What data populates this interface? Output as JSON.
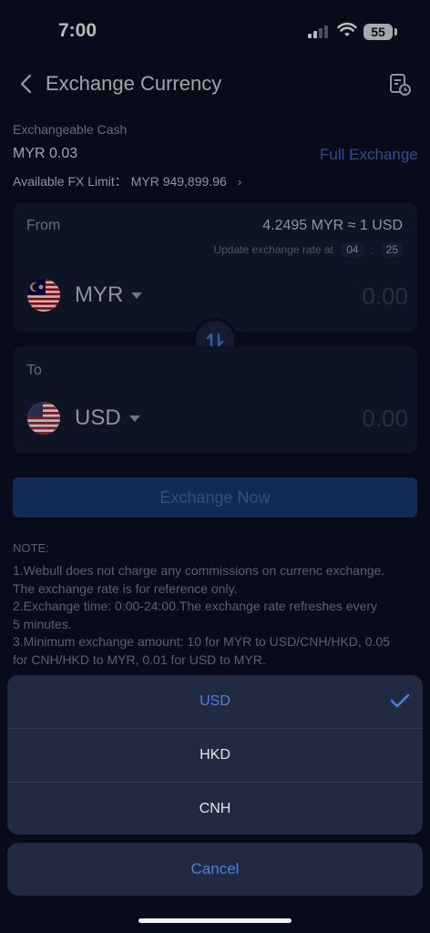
{
  "status": {
    "time": "7:00",
    "battery": "55"
  },
  "header": {
    "title": "Exchange Currency"
  },
  "cash": {
    "label": "Exchangeable Cash",
    "value": "MYR 0.03",
    "full_exchange": "Full Exchange"
  },
  "fx_limit": {
    "label": "Available FX Limit：",
    "value": "MYR 949,899.96"
  },
  "from": {
    "label": "From",
    "rate": "4.2495 MYR ≈ 1 USD",
    "update_label": "Update exchange rate at",
    "update_min": "04",
    "update_sec": "25",
    "currency": "MYR",
    "amount_placeholder": "0.00"
  },
  "to": {
    "label": "To",
    "currency": "USD",
    "amount_placeholder": "0.00"
  },
  "exchange_button": "Exchange Now",
  "note": {
    "title": "NOTE:",
    "lines": [
      "1.Webull does not charge any commissions on currenc exchange.",
      "The exchange rate is for reference only.",
      "2.Exchange time: 0:00-24:00.The exchange rate refreshes every",
      "5 minutes.",
      "3.Minimum exchange amount: 10 for MYR to USD/CNH/HKD, 0.05",
      "for CNH/HKD to MYR, 0.01 for USD to MYR."
    ]
  },
  "sheet": {
    "options": [
      "USD",
      "HKD",
      "CNH"
    ],
    "selected": "USD",
    "cancel": "Cancel"
  },
  "colors": {
    "accent": "#4a7fe0",
    "background": "#0c1125",
    "card": "#161c32"
  }
}
